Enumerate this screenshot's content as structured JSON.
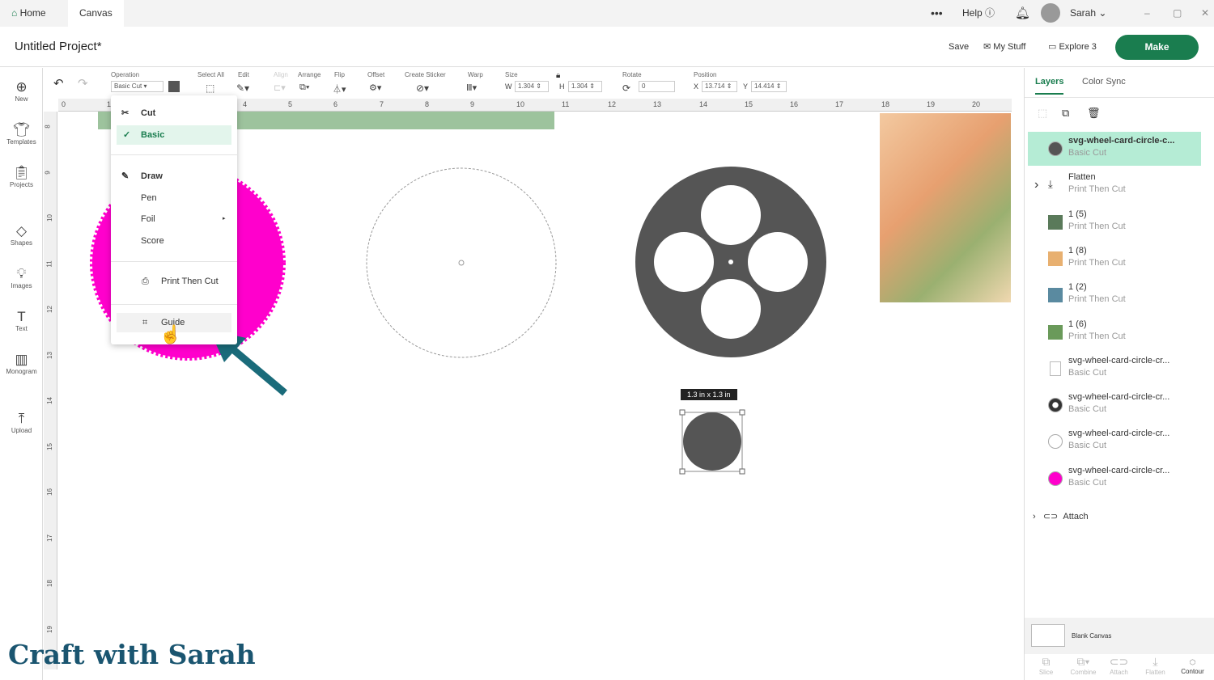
{
  "topbar": {
    "tabs": [
      "Home",
      "Canvas"
    ],
    "more": "•••",
    "help": "Help",
    "user": "Sarah"
  },
  "header": {
    "title": "Untitled Project*",
    "save": "Save",
    "my_stuff": "My Stuff",
    "explore": "Explore 3",
    "make": "Make"
  },
  "leftbar": [
    "New",
    "Templates",
    "Projects",
    "Shapes",
    "Images",
    "Text",
    "Monogram",
    "Upload"
  ],
  "toolbar": {
    "operation_label": "Operation",
    "operation_value": "Basic Cut",
    "select_all": "Select All",
    "edit": "Edit",
    "align": "Align",
    "arrange": "Arrange",
    "flip": "Flip",
    "offset": "Offset",
    "create_sticker": "Create Sticker",
    "warp": "Warp",
    "size": "Size",
    "w_label": "W",
    "w": "1.304",
    "h_label": "H",
    "h": "1.304",
    "rotate": "Rotate",
    "rotate_value": "0",
    "position": "Position",
    "x_label": "X",
    "x": "13.714",
    "y_label": "Y",
    "y": "14.414"
  },
  "ruler_h": [
    "0",
    "1",
    "4",
    "5",
    "6",
    "7",
    "8",
    "9",
    "10",
    "11",
    "12",
    "13",
    "14",
    "15",
    "16",
    "17",
    "18",
    "19",
    "20"
  ],
  "ruler_v": [
    "8",
    "9",
    "10",
    "11",
    "12",
    "13",
    "14",
    "15",
    "16",
    "17",
    "18",
    "19"
  ],
  "menu": {
    "cut": "Cut",
    "basic": "Basic",
    "draw": "Draw",
    "pen": "Pen",
    "foil": "Foil",
    "score": "Score",
    "print_then_cut": "Print Then Cut",
    "guide": "Guide"
  },
  "size_badge": "1.3  in x 1.3  in",
  "watermark": "Craft with Sarah",
  "rpanel": {
    "tabs": [
      "Layers",
      "Color Sync"
    ],
    "layers": [
      {
        "name": "svg-wheel-card-circle-c...",
        "op": "Basic Cut",
        "color": "#555555"
      },
      {
        "name": "Flatten",
        "op": "Print Then Cut",
        "color": ""
      },
      {
        "name": "1 (5)",
        "op": "Print Then Cut",
        "color": "#5a7a5a"
      },
      {
        "name": "1 (8)",
        "op": "Print Then Cut",
        "color": "#e8b070"
      },
      {
        "name": "1 (2)",
        "op": "Print Then Cut",
        "color": "#5a8aa0"
      },
      {
        "name": "1 (6)",
        "op": "Print Then Cut",
        "color": "#6a9a5a"
      },
      {
        "name": "svg-wheel-card-circle-cr...",
        "op": "Basic Cut",
        "color": "#ffffff"
      },
      {
        "name": "svg-wheel-card-circle-cr...",
        "op": "Basic Cut",
        "color": "#333333"
      },
      {
        "name": "svg-wheel-card-circle-cr...",
        "op": "Basic Cut",
        "color": "#ffffff"
      },
      {
        "name": "svg-wheel-card-circle-cr...",
        "op": "Basic Cut",
        "color": "#ff00cc"
      }
    ],
    "attach": "Attach",
    "blank_canvas": "Blank Canvas",
    "bottom": [
      "Slice",
      "Combine",
      "Attach",
      "Flatten",
      "Contour"
    ]
  },
  "colors": {
    "accent": "#1a7d4f",
    "magenta": "#ff00cc",
    "dark": "#555555",
    "arrow": "#1a6b7a"
  }
}
